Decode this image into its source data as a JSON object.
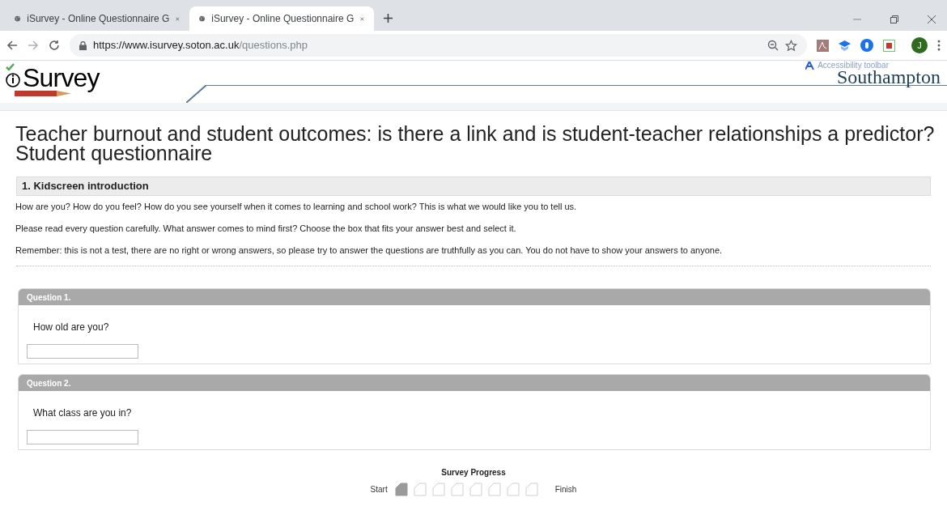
{
  "browser": {
    "tabs": [
      {
        "title": "iSurvey - Online Questionnaire G",
        "selected": false
      },
      {
        "title": "iSurvey - Online Questionnaire G",
        "selected": true
      }
    ],
    "url_host": "https://www.isurvey.soton.ac.uk",
    "url_path": "/questions.php",
    "profile_initial": "J"
  },
  "header": {
    "logo": "Survey",
    "accessibility_link": "Accessibility toolbar",
    "university": "Southampton"
  },
  "survey": {
    "title": "Teacher burnout and student outcomes: is there a link and is student-teacher relationships a predictor?",
    "subtitle": "Student questionnaire",
    "section": "1. Kidscreen introduction",
    "paragraphs": [
      "How are you? How do you feel?  How do you see yourself when it comes to learning and school work? This is what we would like you to tell us.",
      "Please read every question carefully. What answer comes to mind first? Choose the box that fits your answer best and select it.",
      "Remember: this is not a test, there are no right or wrong answers, so please try to answer the questions are truthfully as you can.  You do not have to show your answers to anyone."
    ],
    "questions": [
      {
        "label": "Question 1.",
        "text": "How old are you?"
      },
      {
        "label": "Question 2.",
        "text": "What class are you in?"
      }
    ]
  },
  "progress": {
    "title": "Survey Progress",
    "start": "Start",
    "finish": "Finish",
    "steps": [
      {
        "done": true
      },
      {
        "done": false
      },
      {
        "done": false
      },
      {
        "done": false
      },
      {
        "done": false
      },
      {
        "done": false
      },
      {
        "done": false
      },
      {
        "done": false
      }
    ]
  }
}
